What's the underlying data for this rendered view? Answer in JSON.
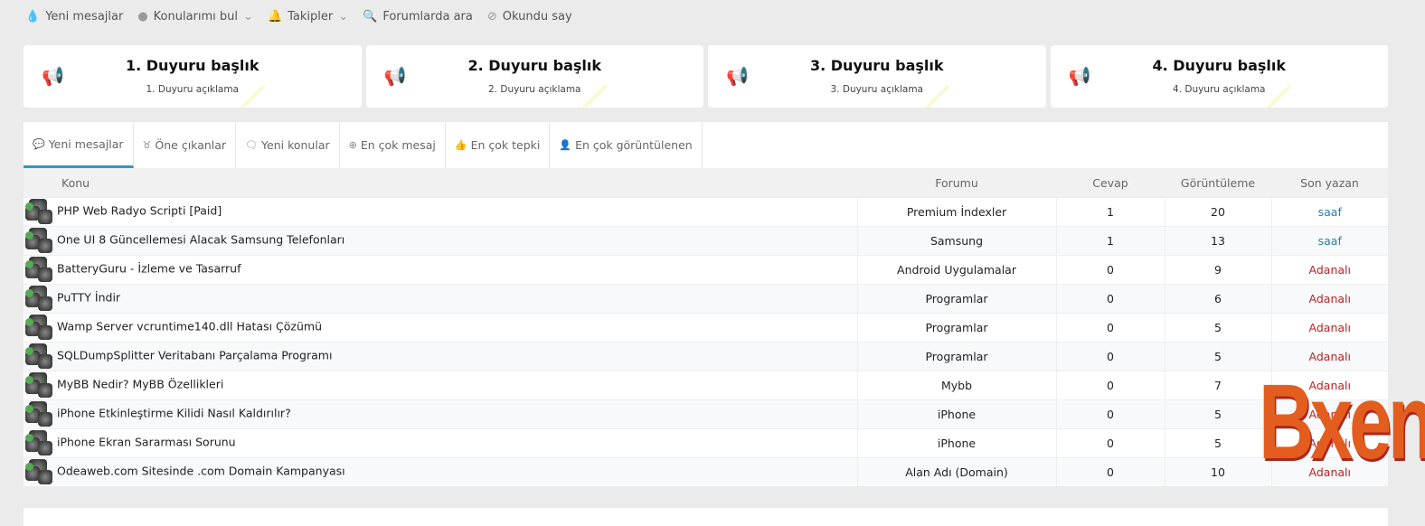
{
  "topnav": [
    {
      "icon": "flame-icon",
      "label": "Yeni mesajlar"
    },
    {
      "icon": "comment-icon",
      "label": "Konularımı bul",
      "dropdown": true
    },
    {
      "icon": "bell-icon",
      "label": "Takipler",
      "dropdown": true
    },
    {
      "icon": "search-icon",
      "label": "Forumlarda ara"
    },
    {
      "icon": "eye-slash-icon",
      "label": "Okundu say"
    }
  ],
  "announcements": [
    {
      "title": "1. Duyuru başlık",
      "desc": "1. Duyuru açıklama"
    },
    {
      "title": "2. Duyuru başlık",
      "desc": "2. Duyuru açıklama"
    },
    {
      "title": "3. Duyuru başlık",
      "desc": "3. Duyuru açıklama"
    },
    {
      "title": "4. Duyuru başlık",
      "desc": "4. Duyuru açıklama"
    }
  ],
  "tabs": [
    {
      "icon": "comment-dots-icon",
      "label": "Yeni mesajlar",
      "active": true
    },
    {
      "icon": "medal-icon",
      "label": "Öne çıkanlar"
    },
    {
      "icon": "comments-icon",
      "label": "Yeni konular"
    },
    {
      "icon": "comment-plus-icon",
      "label": "En çok mesaj"
    },
    {
      "icon": "thumbs-up-icon",
      "label": "En çok tepki"
    },
    {
      "icon": "user-icon",
      "label": "En çok görüntülenen"
    }
  ],
  "table": {
    "headers": [
      "Konu",
      "Forumu",
      "Cevap",
      "Görüntüleme",
      "Son yazan"
    ],
    "rows": [
      [
        "PHP Web Radyo Scripti [Paid]",
        "Premium İndexler",
        "1",
        "20",
        "saaf"
      ],
      [
        "One UI 8 Güncellemesi Alacak Samsung Telefonları",
        "Samsung",
        "1",
        "13",
        "saaf"
      ],
      [
        "BatteryGuru - İzleme ve Tasarruf",
        "Android Uygulamalar",
        "0",
        "9",
        "Adanalı"
      ],
      [
        "PuTTY İndir",
        "Programlar",
        "0",
        "6",
        "Adanalı"
      ],
      [
        "Wamp Server vcruntime140.dll Hatası Çözümü",
        "Programlar",
        "0",
        "5",
        "Adanalı"
      ],
      [
        "SQLDumpSplitter Veritabanı Parçalama Programı",
        "Programlar",
        "0",
        "5",
        "Adanalı"
      ],
      [
        "MyBB Nedir? MyBB Özellikleri",
        "Mybb",
        "0",
        "7",
        "Adanalı"
      ],
      [
        "iPhone Etkinleştirme Kilidi Nasıl Kaldırılır?",
        "iPhone",
        "0",
        "5",
        "Adanalı"
      ],
      [
        "iPhone Ekran Sararması Sorunu",
        "iPhone",
        "0",
        "5",
        "Adanalı"
      ],
      [
        "Odeaweb.com Sitesinde .com Domain Kampanyası",
        "Alan Adı (Domain)",
        "0",
        "10",
        "Adanalı"
      ]
    ]
  },
  "watermark": "Bxen",
  "colors": {
    "accent": "#2a9bc0",
    "user_blue": "#2a7fa8",
    "user_red": "#b22222"
  }
}
